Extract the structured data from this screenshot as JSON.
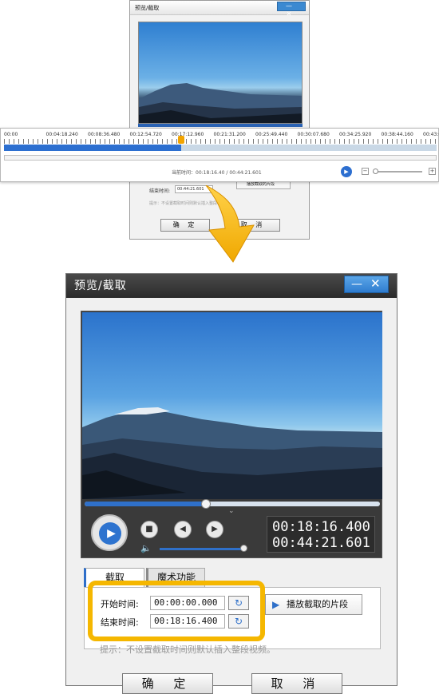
{
  "top_dialog": {
    "title": "预览/截取",
    "window_controls": "— ✕",
    "end_label": "结束时间:",
    "end_value": "00:44:21.601",
    "play_segment_label": "播放截取的片段",
    "tip": "提示：不设置截取时间则默认插入整段视频。",
    "ok_label": "确 定",
    "cancel_label": "取 消"
  },
  "timeline": {
    "ticks": [
      "00:00",
      "00:04:18.240",
      "00:08:36.480",
      "00:12:54.720",
      "00:17:12.960",
      "00:21:31.200",
      "00:25:49.440",
      "00:30:07.680",
      "00:34:25.920",
      "00:38:44.160",
      "00:43:02.40"
    ],
    "position": 0.41,
    "current_text": "当前时间：00:18:16.40 / 00:44:21.601",
    "zoom_out": "−",
    "zoom_in": "+",
    "zoom_level": 0.0
  },
  "dialog": {
    "title": "预览/截取",
    "minimize_icon": "—",
    "close_icon": "✕",
    "playback_position": 0.41,
    "volume": 1.0,
    "current_time": "00:18:16.400",
    "total_time": "00:44:21.601",
    "tabs": [
      {
        "label": "截取",
        "active": true
      },
      {
        "label": "魔术功能",
        "active": false
      }
    ],
    "start_label": "开始时间:",
    "start_value": "00:00:00.000",
    "end_label": "结束时间:",
    "end_value": "00:18:16.400",
    "play_segment_label": "播放截取的片段",
    "tip": "提示：不设置截取时间则默认插入整段视频。",
    "ok_label": "确 定",
    "cancel_label": "取 消"
  },
  "colors": {
    "accent_blue": "#2f70c9",
    "highlight_yellow": "#f5b700",
    "titlebar_dark": "#2b2b2b"
  },
  "icons": {
    "play": "play-icon",
    "stop": "stop-icon",
    "prev_frame": "prev-frame-icon",
    "next_frame": "next-frame-icon",
    "volume": "volume-icon",
    "clock": "clock-reset-icon"
  }
}
